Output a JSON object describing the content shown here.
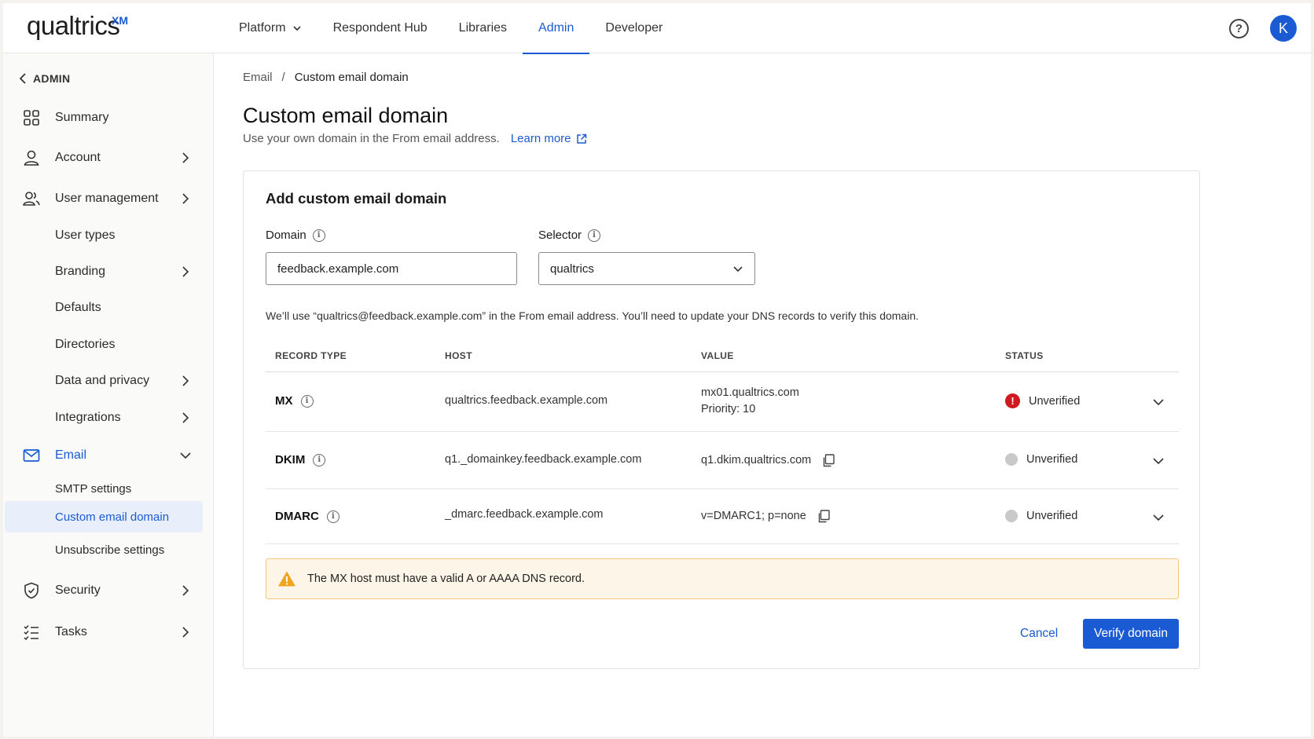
{
  "brand": {
    "name": "qualtrics",
    "suffix": "XM",
    "accent": "#1a5bd4"
  },
  "topnav": {
    "items": [
      {
        "label": "Platform",
        "has_dropdown": true
      },
      {
        "label": "Respondent Hub"
      },
      {
        "label": "Libraries"
      },
      {
        "label": "Admin",
        "active": true
      },
      {
        "label": "Developer"
      }
    ],
    "avatar_initial": "K",
    "help_icon": "help-circle-icon"
  },
  "sidebar": {
    "back_label": "ADMIN",
    "items": [
      {
        "label": "Summary",
        "icon": "grid-icon"
      },
      {
        "label": "Account",
        "icon": "person-icon",
        "chevron": true
      },
      {
        "label": "User management",
        "icon": "users-icon",
        "chevron": true
      },
      {
        "label": "User types"
      },
      {
        "label": "Branding",
        "chevron": true
      },
      {
        "label": "Defaults"
      },
      {
        "label": "Directories"
      },
      {
        "label": "Data and privacy",
        "chevron": true
      },
      {
        "label": "Integrations",
        "chevron": true
      },
      {
        "label": "Email",
        "icon": "mail-icon",
        "expanded": true
      },
      {
        "label": "SMTP settings"
      },
      {
        "label": "Custom email domain",
        "selected": true
      },
      {
        "label": "Unsubscribe settings"
      },
      {
        "label": "Security",
        "icon": "shield-icon",
        "chevron": true
      },
      {
        "label": "Tasks",
        "icon": "tasks-icon",
        "chevron": true
      }
    ]
  },
  "breadcrumb": {
    "parent": "Email",
    "separator": "/",
    "current": "Custom email domain"
  },
  "page": {
    "title": "Custom email domain",
    "subtitle": "Use your own domain in the From email address.",
    "learn_more": "Learn more"
  },
  "form": {
    "card_title": "Add custom email domain",
    "domain_label": "Domain",
    "domain_value": "feedback.example.com",
    "selector_label": "Selector",
    "selector_value": "qualtrics",
    "hint": "We’ll use “qualtrics@feedback.example.com” in the From email address. You’ll need to update your DNS records to verify this domain."
  },
  "table": {
    "headers": {
      "type": "RECORD TYPE",
      "host": "HOST",
      "value": "VALUE",
      "status": "STATUS"
    },
    "rows": [
      {
        "type": "MX",
        "host": "qualtrics.feedback.example.com",
        "value": "mx01.qualtrics.com",
        "value2": "Priority: 10",
        "status": "Unverified",
        "status_kind": "error"
      },
      {
        "type": "DKIM",
        "host": "q1._domainkey.feedback.example.com",
        "value": "q1.dkim.qualtrics.com",
        "status": "Unverified",
        "status_kind": "pending"
      },
      {
        "type": "DMARC",
        "host": "_dmarc.feedback.example.com",
        "value": "v=DMARC1; p=none",
        "status": "Unverified",
        "status_kind": "pending"
      }
    ]
  },
  "warning": {
    "text": "The MX host must have a valid A or AAAA DNS record.",
    "color": "#f0a51e"
  },
  "actions": {
    "cancel": "Cancel",
    "verify": "Verify domain"
  }
}
